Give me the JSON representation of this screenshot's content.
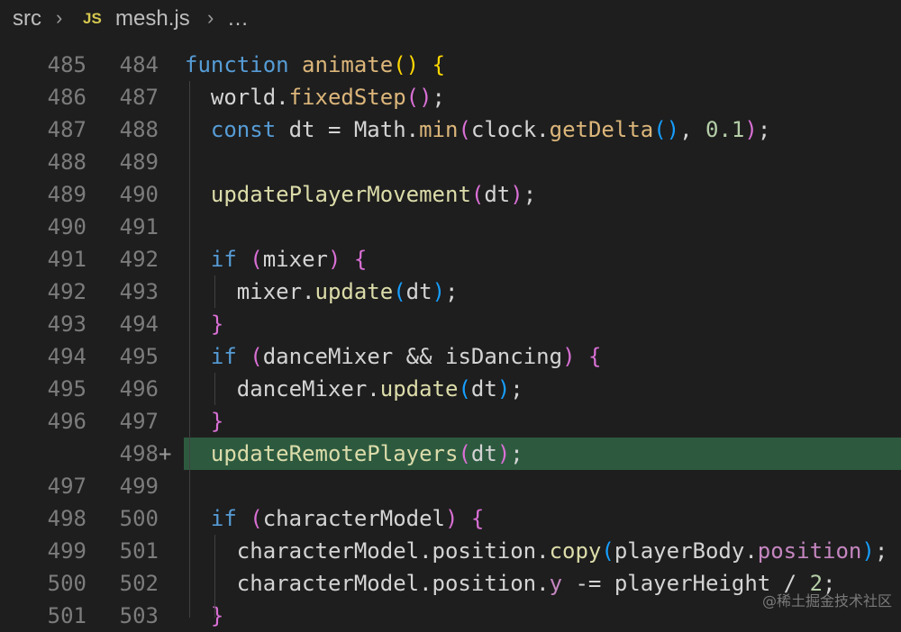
{
  "breadcrumb": {
    "folder": "src",
    "file_icon": "JS",
    "file": "mesh.js",
    "more": "…"
  },
  "lines": [
    {
      "old": "485",
      "new": "484",
      "tokens": [
        [
          "function",
          "kw"
        ],
        [
          " ",
          "var"
        ],
        [
          "animate",
          "fn2"
        ],
        [
          "()",
          "p1"
        ],
        [
          " ",
          "var"
        ],
        [
          "{",
          "p1"
        ]
      ]
    },
    {
      "old": "486",
      "new": "487",
      "tokens": [
        [
          "  world.",
          "var"
        ],
        [
          "fixedStep",
          "fn2"
        ],
        [
          "()",
          "p2"
        ],
        [
          ";",
          "var"
        ]
      ]
    },
    {
      "old": "487",
      "new": "488",
      "tokens": [
        [
          "  ",
          "var"
        ],
        [
          "const",
          "kw"
        ],
        [
          " dt = Math.",
          "var"
        ],
        [
          "min",
          "fn2"
        ],
        [
          "(",
          "p2"
        ],
        [
          "clock.",
          "var"
        ],
        [
          "getDelta",
          "fn2"
        ],
        [
          "()",
          "p3"
        ],
        [
          ", ",
          "var"
        ],
        [
          "0.1",
          "num"
        ],
        [
          ")",
          "p2"
        ],
        [
          ";",
          "var"
        ]
      ]
    },
    {
      "old": "488",
      "new": "489",
      "tokens": []
    },
    {
      "old": "489",
      "new": "490",
      "tokens": [
        [
          "  ",
          "var"
        ],
        [
          "updatePlayerMovement",
          "fn"
        ],
        [
          "(",
          "p2"
        ],
        [
          "dt",
          "var"
        ],
        [
          ")",
          "p2"
        ],
        [
          ";",
          "var"
        ]
      ]
    },
    {
      "old": "490",
      "new": "491",
      "tokens": []
    },
    {
      "old": "491",
      "new": "492",
      "tokens": [
        [
          "  ",
          "var"
        ],
        [
          "if",
          "kw"
        ],
        [
          " ",
          "var"
        ],
        [
          "(",
          "p2"
        ],
        [
          "mixer",
          "var"
        ],
        [
          ")",
          "p2"
        ],
        [
          " ",
          "var"
        ],
        [
          "{",
          "p2"
        ]
      ]
    },
    {
      "old": "492",
      "new": "493",
      "tokens": [
        [
          "    mixer.",
          "var"
        ],
        [
          "update",
          "fn"
        ],
        [
          "(",
          "p3"
        ],
        [
          "dt",
          "var"
        ],
        [
          ")",
          "p3"
        ],
        [
          ";",
          "var"
        ]
      ]
    },
    {
      "old": "493",
      "new": "494",
      "tokens": [
        [
          "  ",
          "var"
        ],
        [
          "}",
          "p2"
        ]
      ]
    },
    {
      "old": "494",
      "new": "495",
      "tokens": [
        [
          "  ",
          "var"
        ],
        [
          "if",
          "kw"
        ],
        [
          " ",
          "var"
        ],
        [
          "(",
          "p2"
        ],
        [
          "danceMixer && isDancing",
          "var"
        ],
        [
          ")",
          "p2"
        ],
        [
          " ",
          "var"
        ],
        [
          "{",
          "p2"
        ]
      ]
    },
    {
      "old": "495",
      "new": "496",
      "tokens": [
        [
          "    danceMixer.",
          "var"
        ],
        [
          "update",
          "fn"
        ],
        [
          "(",
          "p3"
        ],
        [
          "dt",
          "var"
        ],
        [
          ")",
          "p3"
        ],
        [
          ";",
          "var"
        ]
      ]
    },
    {
      "old": "496",
      "new": "497",
      "tokens": [
        [
          "  ",
          "var"
        ],
        [
          "}",
          "p2"
        ]
      ]
    },
    {
      "old": "",
      "new": "498",
      "added": true,
      "tokens": [
        [
          "  ",
          "var"
        ],
        [
          "updateRemotePlayers",
          "fn"
        ],
        [
          "(",
          "p2"
        ],
        [
          "dt",
          "var"
        ],
        [
          ")",
          "p2"
        ],
        [
          ";",
          "var"
        ]
      ]
    },
    {
      "old": "497",
      "new": "499",
      "tokens": []
    },
    {
      "old": "498",
      "new": "500",
      "tokens": [
        [
          "  ",
          "var"
        ],
        [
          "if",
          "kw"
        ],
        [
          " ",
          "var"
        ],
        [
          "(",
          "p2"
        ],
        [
          "characterModel",
          "var"
        ],
        [
          ")",
          "p2"
        ],
        [
          " ",
          "var"
        ],
        [
          "{",
          "p2"
        ]
      ]
    },
    {
      "old": "499",
      "new": "501",
      "tokens": [
        [
          "    characterModel.position.",
          "var"
        ],
        [
          "copy",
          "fn"
        ],
        [
          "(",
          "p3"
        ],
        [
          "playerBody.",
          "var"
        ],
        [
          "position",
          "prop"
        ],
        [
          ")",
          "p3"
        ],
        [
          ";",
          "var"
        ]
      ]
    },
    {
      "old": "500",
      "new": "502",
      "tokens": [
        [
          "    characterModel.position.",
          "var"
        ],
        [
          "y",
          "prop"
        ],
        [
          " -= playerHeight / ",
          "var"
        ],
        [
          "2",
          "num"
        ],
        [
          ";",
          "var"
        ]
      ]
    },
    {
      "old": "501",
      "new": "503",
      "tokens": [
        [
          "  ",
          "var"
        ],
        [
          "}",
          "p2"
        ]
      ]
    }
  ],
  "watermark": "@稀土掘金技术社区",
  "colors": {
    "background": "#1e1e1e",
    "added_line": "#2d5a3f"
  }
}
